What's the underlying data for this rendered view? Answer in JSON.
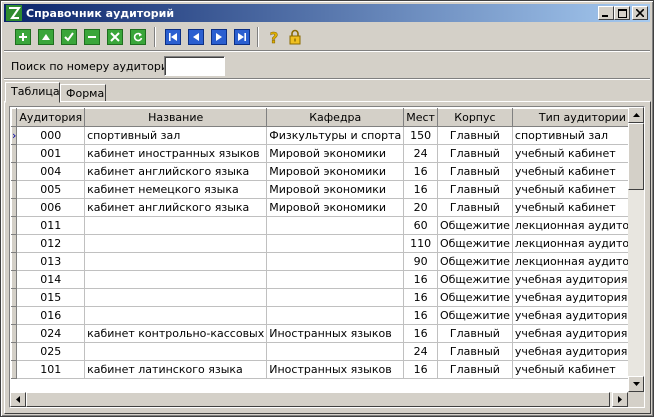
{
  "window": {
    "title": "Справочник аудиторий",
    "buttons": [
      "minimize-icon",
      "maximize-icon",
      "close-icon"
    ]
  },
  "toolbar": {
    "icons": [
      "add-icon",
      "move-up-icon",
      "confirm-icon",
      "delete-icon",
      "cancel-icon",
      "refresh-icon",
      "first-record-icon",
      "prev-record-icon",
      "next-record-icon",
      "last-record-icon",
      "help-icon",
      "lock-icon"
    ]
  },
  "search": {
    "label": "Поиск по номеру аудитории:",
    "value": ""
  },
  "tabs": [
    {
      "label": "Таблица",
      "active": true
    },
    {
      "label": "Форма",
      "active": false
    }
  ],
  "table": {
    "columns": [
      "Аудитория",
      "Название",
      "Кафедра",
      "Мест",
      "Корпус",
      "Тип аудитории"
    ],
    "current_row_indicator": "›",
    "rows": [
      [
        "000",
        "спортивный зал",
        "Физкультуры и спорта",
        "150",
        "Главный",
        "спортивный зал"
      ],
      [
        "001",
        "кабинет иностранных языков",
        "Мировой экономики",
        "24",
        "Главный",
        "учебный кабинет"
      ],
      [
        "004",
        "кабинет английского языка",
        "Мировой экономики",
        "16",
        "Главный",
        "учебный кабинет"
      ],
      [
        "005",
        "кабинет немецкого языка",
        "Мировой экономики",
        "16",
        "Главный",
        "учебный кабинет"
      ],
      [
        "006",
        "кабинет английского языка",
        "Мировой экономики",
        "20",
        "Главный",
        "учебный кабинет"
      ],
      [
        "011",
        "",
        "",
        "60",
        "Общежитие",
        "лекционная аудитория"
      ],
      [
        "012",
        "",
        "",
        "110",
        "Общежитие",
        "лекционная аудитория"
      ],
      [
        "013",
        "",
        "",
        "90",
        "Общежитие",
        "лекционная аудитория"
      ],
      [
        "014",
        "",
        "",
        "16",
        "Общежитие",
        "учебная аудитория"
      ],
      [
        "015",
        "",
        "",
        "16",
        "Общежитие",
        "учебная аудитория"
      ],
      [
        "016",
        "",
        "",
        "16",
        "Общежитие",
        "учебная аудитория"
      ],
      [
        "024",
        "кабинет контрольно-кассовых",
        "Иностранных языков",
        "16",
        "Главный",
        "учебная аудитория"
      ],
      [
        "025",
        "",
        "",
        "24",
        "Главный",
        "учебная аудитория"
      ],
      [
        "101",
        "кабинет латинского языка",
        "Иностранных языков",
        "16",
        "Главный",
        "учебный кабинет"
      ]
    ]
  },
  "colors": {
    "titlebar_start": "#0a246a",
    "titlebar_end": "#a6caf0",
    "face": "#d4d0c8"
  }
}
